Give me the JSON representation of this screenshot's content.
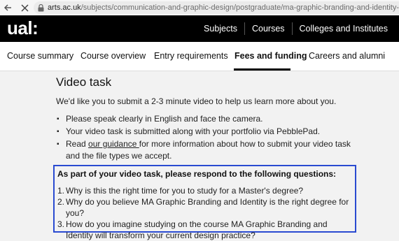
{
  "browser": {
    "back_icon": "arrow-left-icon",
    "stop_icon": "close-icon",
    "url_domain": "arts.ac.uk",
    "url_path": "/subjects/communication-and-graphic-design/postgraduate/ma-graphic-branding-and-identity-lcc#fees-a"
  },
  "header": {
    "logo": "ual:",
    "links": [
      "Subjects",
      "Courses",
      "Colleges and Institutes"
    ]
  },
  "tabs": [
    {
      "label": "Course summary",
      "active": false
    },
    {
      "label": "Course overview",
      "active": false
    },
    {
      "label": "Entry requirements",
      "active": false
    },
    {
      "label": "Fees and funding",
      "active": true
    },
    {
      "label": "Careers and alumni",
      "active": false
    }
  ],
  "main": {
    "title": "Video task",
    "intro": "We'd like you to submit a 2-3 minute video to help us learn more about you.",
    "bullets": {
      "b1": "Please speak clearly in English and face the camera.",
      "b2": "Your video task is submitted along with your portfolio via PebblePad.",
      "b3_pre": "Read ",
      "b3_link": "our guidance ",
      "b3_post": "for more information about how to submit your video task and the file types we accept."
    },
    "questions_heading": "As part of your video task, please respond to the following questions:",
    "questions": [
      {
        "n": "1.",
        "text": "Why is this the right time for you to study for a Master's degree?"
      },
      {
        "n": "2.",
        "text": "Why do you believe MA Graphic Branding and Identity is the right degree for you?"
      },
      {
        "n": "3.",
        "text": "How do you imagine studying on the course MA Graphic Branding and Identity will transform your current design practice?"
      }
    ],
    "highlight_color": "#2a4bd1"
  }
}
